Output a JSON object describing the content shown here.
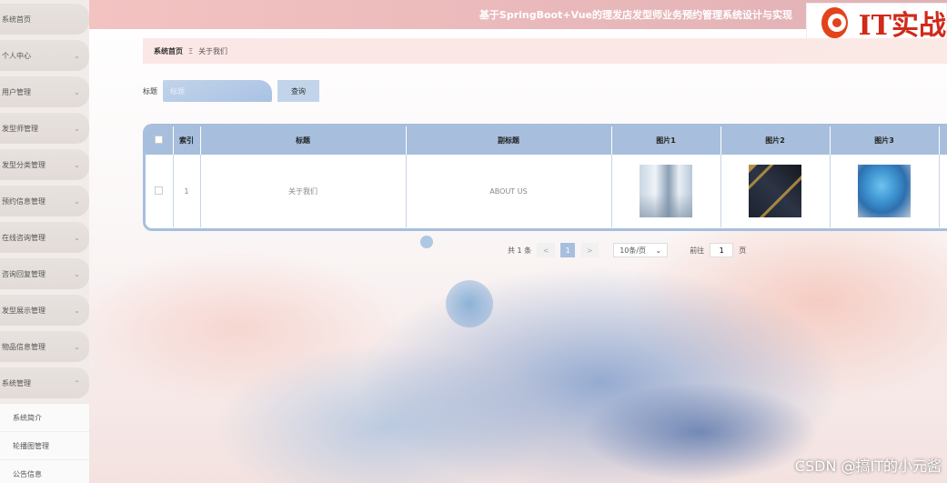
{
  "header": {
    "title": "基于SpringBoot+Vue的理发店发型师业务预约管理系统设计与实现",
    "logo_text": "IT实战"
  },
  "sidebar": {
    "items": [
      {
        "label": "系统首页",
        "has_chevron": false
      },
      {
        "label": "个人中心",
        "has_chevron": true
      },
      {
        "label": "用户管理",
        "has_chevron": true
      },
      {
        "label": "发型师管理",
        "has_chevron": true
      },
      {
        "label": "发型分类管理",
        "has_chevron": true
      },
      {
        "label": "预约信息管理",
        "has_chevron": true
      },
      {
        "label": "在线咨询管理",
        "has_chevron": true
      },
      {
        "label": "咨询回复管理",
        "has_chevron": true
      },
      {
        "label": "发型展示管理",
        "has_chevron": true
      },
      {
        "label": "物品信息管理",
        "has_chevron": true
      },
      {
        "label": "系统管理",
        "has_chevron": true,
        "expanded": true
      }
    ],
    "submenu": [
      "系统简介",
      "轮播图管理",
      "公告信息"
    ],
    "chevron_glyph": "⌄",
    "chevron_up_glyph": "⌃"
  },
  "breadcrumb": {
    "home": "系统首页",
    "separator": "Ξ",
    "current": "关于我们"
  },
  "search": {
    "label": "标题",
    "placeholder": "标题",
    "button": "查询"
  },
  "table": {
    "headers": [
      "",
      "索引",
      "标题",
      "副标题",
      "图片1",
      "图片2",
      "图片3"
    ],
    "rows": [
      {
        "index": "1",
        "title": "关于我们",
        "subtitle": "ABOUT US"
      }
    ]
  },
  "pagination": {
    "total": "共 1 条",
    "prev": "<",
    "current_page": "1",
    "next": ">",
    "page_size": "10条/页",
    "goto_label": "前往",
    "goto_value": "1",
    "page_suffix": "页"
  },
  "watermark": "CSDN @搞IT的小元酱",
  "colors": {
    "accent": "#a7bfdd",
    "header": "#eab9bb",
    "logo_red": "#d02a1a"
  }
}
